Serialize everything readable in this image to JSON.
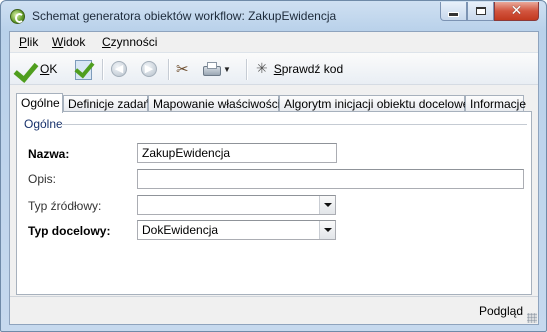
{
  "window": {
    "title": "Schemat generatora obiektów workflow: ZakupEwidencja",
    "caption_buttons": {
      "minimize_icon": "minimize-icon",
      "maximize_icon": "maximize-icon",
      "close_icon": "close-icon",
      "close_glyph": "✕"
    }
  },
  "menubar": {
    "items": [
      {
        "hotkey": "P",
        "rest": "lik"
      },
      {
        "hotkey": "W",
        "rest": "idok"
      },
      {
        "hotkey": "C",
        "rest": "zynności"
      }
    ]
  },
  "toolbar": {
    "ok": {
      "hotkey": "O",
      "rest": "K",
      "icon": "checkmark-icon"
    },
    "apply_icon": "apply-document-icon",
    "back_icon": "back-arrow-icon",
    "back_glyph": "◀",
    "forward_icon": "forward-arrow-icon",
    "forward_glyph": "▶",
    "tools_icon": "tools-icon",
    "tools_glyph": "✂",
    "print_icon": "printer-icon",
    "print_dropdown_glyph": "▼",
    "check_code": {
      "hotkey": "S",
      "rest": "prawdź kod",
      "icon": "magic-wand-icon",
      "glyph": "✳"
    }
  },
  "tabs": [
    "Ogólne",
    "Definicje zadań",
    "Mapowanie właściwości",
    "Algorytm inicjacji obiektu docelowego",
    "Informacje"
  ],
  "general": {
    "group_label": "Ogólne",
    "fields": {
      "name": {
        "label": "Nazwa:",
        "value": "ZakupEwidencja"
      },
      "description": {
        "label": "Opis:",
        "value": ""
      },
      "source_type": {
        "label": "Typ źródłowy:",
        "value": ""
      },
      "target_type": {
        "label": "Typ docelowy:",
        "value": "DokEwidencja"
      }
    }
  },
  "statusbar": {
    "preview": "Podgląd"
  },
  "colors": {
    "title_bar": "#c6d9ee",
    "close_button": "#c2391f",
    "group_label": "#17316b",
    "ok_check": "#4f9e1e"
  }
}
